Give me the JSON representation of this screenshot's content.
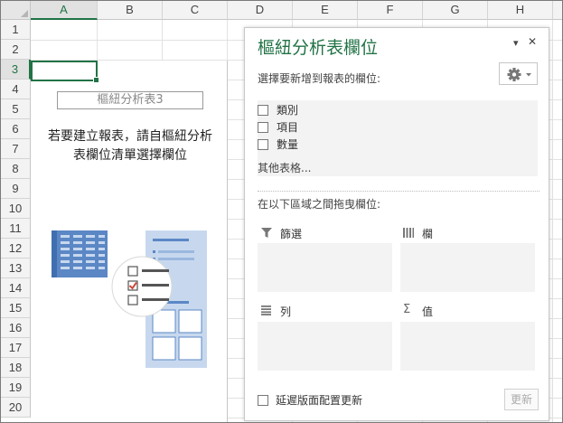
{
  "grid": {
    "columns": [
      "A",
      "B",
      "C",
      "D",
      "E",
      "F",
      "G",
      "H"
    ],
    "selected_column": "A",
    "rows": [
      "1",
      "2",
      "3",
      "4",
      "5",
      "6",
      "7",
      "8",
      "9",
      "10",
      "11",
      "12",
      "13",
      "14",
      "15",
      "16",
      "17",
      "18",
      "19",
      "20"
    ],
    "selected_row": "3"
  },
  "pivot_placeholder": {
    "name": "樞紐分析表3",
    "message_line1": "若要建立報表，請自樞紐分析",
    "message_line2": "表欄位清單選擇欄位"
  },
  "pane": {
    "title": "樞紐分析表欄位",
    "dropdown_icon": "▾",
    "close_icon": "✕",
    "choose_fields_label": "選擇要新增到報表的欄位:",
    "fields": [
      {
        "label": "類別",
        "checked": false
      },
      {
        "label": "項目",
        "checked": false
      },
      {
        "label": "數量",
        "checked": false
      }
    ],
    "more_tables": "其他表格...",
    "drag_label": "在以下區域之間拖曳欄位:",
    "areas": {
      "filters": "篩選",
      "columns": "欄",
      "rows": "列",
      "values": "值"
    },
    "defer_label": "延遲版面配置更新",
    "update_button": "更新"
  },
  "colors": {
    "accent": "#217346",
    "illustration_blue": "#5b87c5",
    "illustration_light": "#c7d8ee"
  }
}
